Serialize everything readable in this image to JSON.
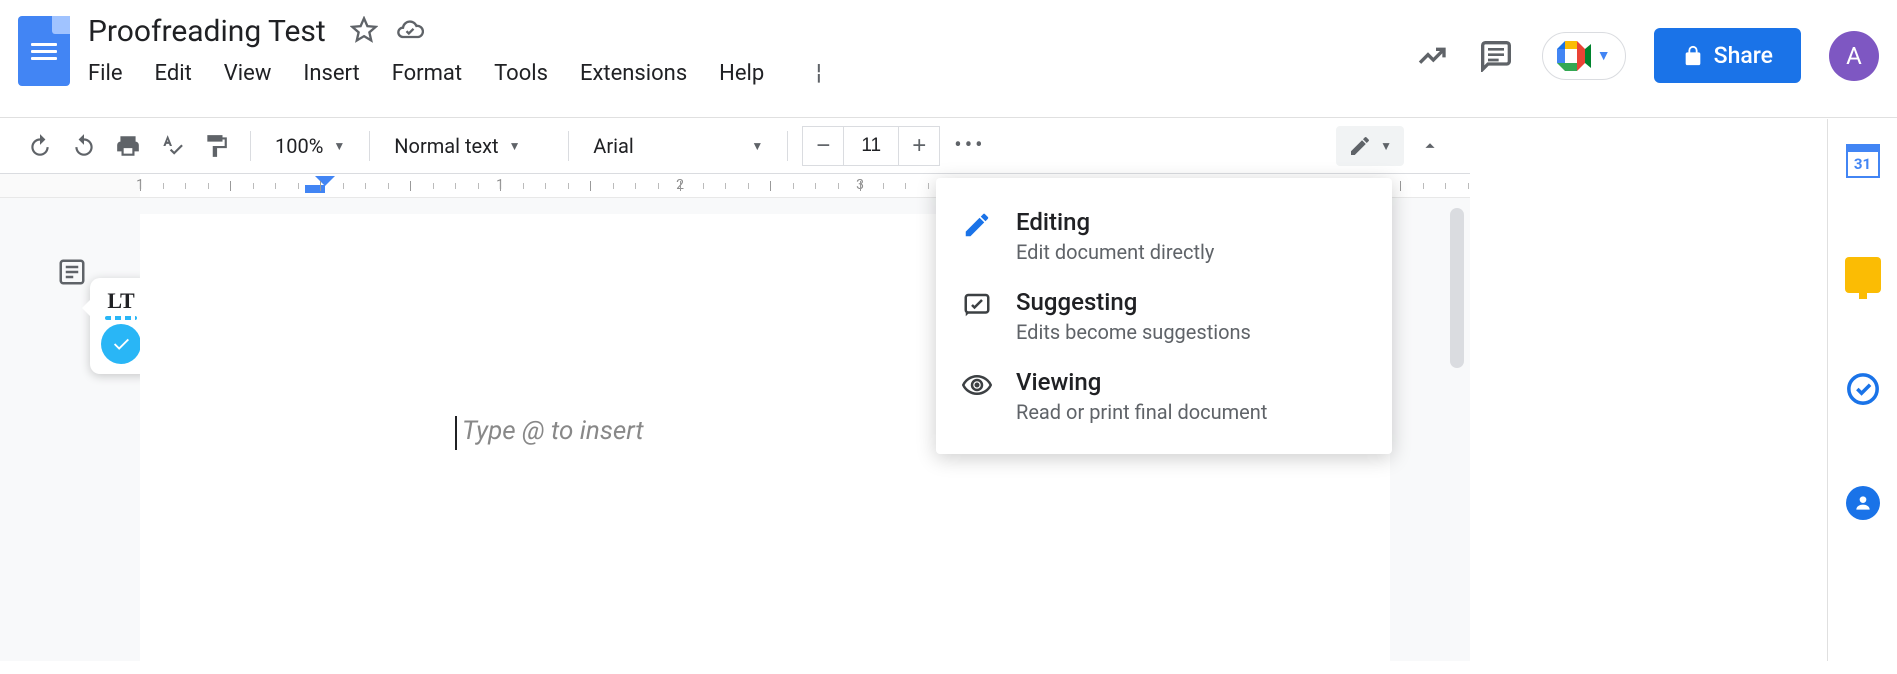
{
  "document": {
    "title": "Proofreading Test",
    "placeholder": "Type @ to insert"
  },
  "menubar": {
    "file": "File",
    "edit": "Edit",
    "view": "View",
    "insert": "Insert",
    "format": "Format",
    "tools": "Tools",
    "extensions": "Extensions",
    "help": "Help"
  },
  "toolbar": {
    "zoom": "100%",
    "style": "Normal text",
    "font": "Arial",
    "fontSize": "11"
  },
  "share": {
    "label": "Share"
  },
  "avatar": {
    "initial": "A"
  },
  "ruler": {
    "marks": [
      "1",
      "1",
      "2",
      "3"
    ]
  },
  "modeMenu": {
    "editing": {
      "title": "Editing",
      "desc": "Edit document directly"
    },
    "suggesting": {
      "title": "Suggesting",
      "desc": "Edits become suggestions"
    },
    "viewing": {
      "title": "Viewing",
      "desc": "Read or print final document"
    }
  },
  "sidepanel": {
    "calendarDay": "31"
  }
}
